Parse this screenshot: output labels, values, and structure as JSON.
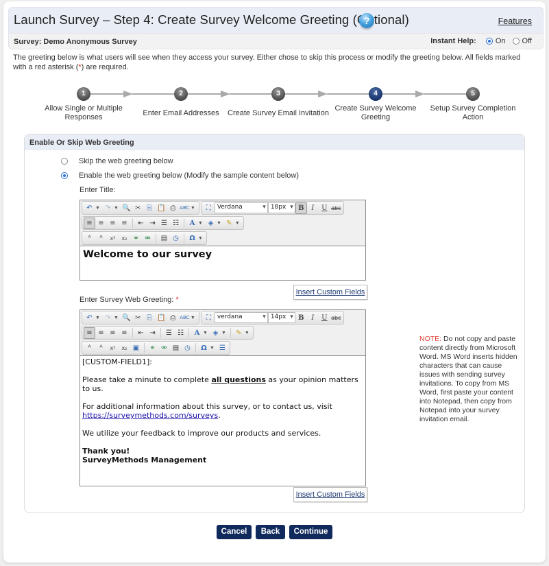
{
  "header": {
    "title": "Launch Survey – Step 4: Create Survey Welcome Greeting (Optional)",
    "help_icon": "question-circle-icon",
    "features_link": "Features",
    "survey_label": "Survey: Demo Anonymous Survey",
    "instant_help": {
      "label": "Instant Help:",
      "options": [
        {
          "label": "On",
          "selected": true
        },
        {
          "label": "Off",
          "selected": false
        }
      ]
    }
  },
  "intro": {
    "text_before": "The greeting below is what users will see when they access your survey. Either chose to skip this process or modify the greeting below. All fields marked with a red asterisk (",
    "asterisk": "*",
    "text_after": ") are required."
  },
  "steps": [
    {
      "number": "1",
      "label": "Allow Single or Multiple Responses",
      "active": false
    },
    {
      "number": "2",
      "label": "Enter Email Addresses",
      "active": false
    },
    {
      "number": "3",
      "label": "Create Survey Email Invitation",
      "active": false
    },
    {
      "number": "4",
      "label": "Create Survey Welcome Greeting",
      "active": true
    },
    {
      "number": "5",
      "label": "Setup Survey Completion Action",
      "active": false
    }
  ],
  "section": {
    "heading": "Enable Or Skip Web Greeting",
    "options": [
      {
        "label": "Skip the web greeting below",
        "selected": false
      },
      {
        "label": "Enable the web greeting below (Modify the sample content below)",
        "selected": true
      }
    ],
    "title_label": "Enter Title:",
    "greeting_label": "Enter Survey Web Greeting:",
    "required_mark": "*",
    "title_editor": {
      "font": "Verdana",
      "size": "18px",
      "bold_active": true,
      "content": "Welcome to our survey"
    },
    "greeting_editor": {
      "font": "verdana",
      "size": "14px",
      "bold_active": false,
      "content": {
        "line1": "[CUSTOM-FIELD1]:",
        "p2_before": "Please take a minute to complete ",
        "p2_emph": "all questions",
        "p2_after": " as your opinion matters to us.",
        "p3_text": "For additional information about this survey, or to contact us, visit ",
        "p3_link": "https://surveymethods.com/surveys",
        "p3_end": ".",
        "p4": "We utilize your feedback to improve our products and services.",
        "sign1": "Thank you!",
        "sign2": "SurveyMethods Management"
      }
    },
    "insert_custom_fields": "Insert Custom Fields",
    "note_label": "NOTE:",
    "note_text": " Do not copy and paste content directly from Microsoft Word. MS Word inserts hidden characters that can cause issues with sending survey invitations. To copy from MS Word, first paste your content into Notepad, then copy from Notepad into your survey invitation email."
  },
  "toolbar": {
    "undo": "↶",
    "redo": "↷",
    "find": "🔍",
    "cut": "✂",
    "copy": "⎘",
    "paste": "📋",
    "print": "⎙",
    "spell": "ABC",
    "fullscreen": "⛶",
    "bold": "B",
    "italic": "I",
    "underline": "U",
    "strike": "abc",
    "align_left": "≡",
    "align_center": "≡",
    "align_right": "≡",
    "justify": "≡",
    "outdent": "⇤",
    "indent": "⇥",
    "bullets": "☰",
    "numbered": "☷",
    "font_color": "A",
    "bg_color": "◈",
    "clean": "✎",
    "superscript_ab": "ᴬ",
    "subscript_ab": "ᴬ",
    "sup": "x²",
    "sub": "x₂",
    "image": "▣",
    "link": "⚭",
    "unlink": "⚮",
    "template": "▤",
    "time": "◷",
    "symbol": "Ω",
    "hr": "☰"
  },
  "buttons": {
    "cancel": "Cancel",
    "back": "Back",
    "continue": "Continue"
  },
  "colors": {
    "primary_button": "#112a5e",
    "header_bg": "#e8edf6",
    "required": "#d9302a",
    "note": "#e0433a",
    "active_step": "#1e3a72"
  }
}
